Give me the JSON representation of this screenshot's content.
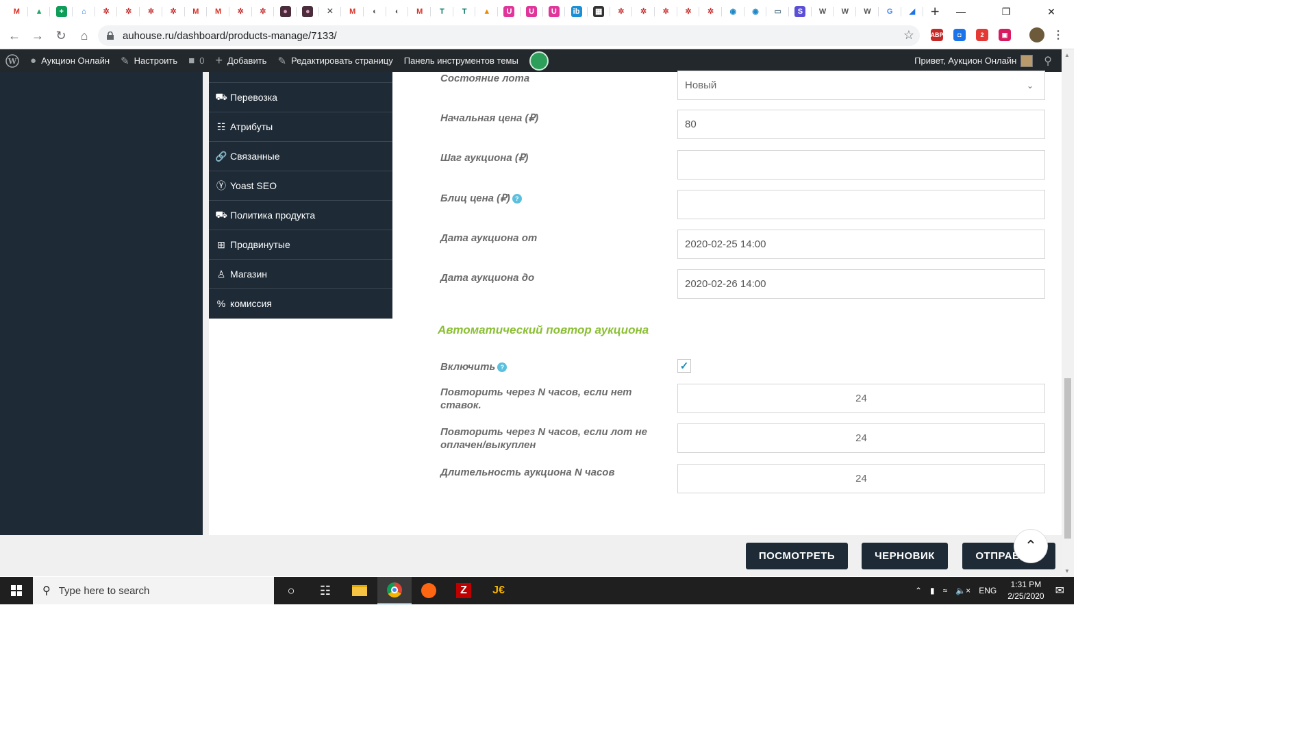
{
  "browser": {
    "favicons": [
      {
        "glyph": "M",
        "bg": "#ffffff",
        "fg": "#d93025"
      },
      {
        "glyph": "▲",
        "bg": "#ffffff",
        "fg": "#1fa463"
      },
      {
        "glyph": "+",
        "bg": "#0f9d58",
        "fg": "#ffffff"
      },
      {
        "glyph": "⌂",
        "bg": "#ffffff",
        "fg": "#1a73e8"
      },
      {
        "glyph": "✲",
        "bg": "#ffffff",
        "fg": "#c62828"
      },
      {
        "glyph": "✲",
        "bg": "#ffffff",
        "fg": "#c62828"
      },
      {
        "glyph": "✲",
        "bg": "#ffffff",
        "fg": "#c62828"
      },
      {
        "glyph": "✲",
        "bg": "#ffffff",
        "fg": "#c62828"
      },
      {
        "glyph": "M",
        "bg": "#ffffff",
        "fg": "#d93025"
      },
      {
        "glyph": "M",
        "bg": "#ffffff",
        "fg": "#d93025"
      },
      {
        "glyph": "✲",
        "bg": "#ffffff",
        "fg": "#c62828"
      },
      {
        "glyph": "✲",
        "bg": "#ffffff",
        "fg": "#c62828"
      },
      {
        "glyph": "●",
        "bg": "#4a2c3a",
        "fg": "#d8a0c0"
      },
      {
        "glyph": "●",
        "bg": "#4a2c3a",
        "fg": "#d8a0c0"
      },
      {
        "glyph": "×",
        "bg": "#ffffff",
        "fg": "#333333"
      },
      {
        "glyph": "M",
        "bg": "#ffffff",
        "fg": "#d93025"
      },
      {
        "glyph": "◐",
        "bg": "#ffffff",
        "fg": "#555555"
      },
      {
        "glyph": "◐",
        "bg": "#ffffff",
        "fg": "#555555"
      },
      {
        "glyph": "M",
        "bg": "#ffffff",
        "fg": "#d93025"
      },
      {
        "glyph": "T",
        "bg": "#ffffff",
        "fg": "#0a7b6b"
      },
      {
        "glyph": "T",
        "bg": "#ffffff",
        "fg": "#0a7b6b"
      },
      {
        "glyph": "▲",
        "bg": "#ffffff",
        "fg": "#e68a00"
      },
      {
        "glyph": "U",
        "bg": "#e0359a",
        "fg": "#ffffff"
      },
      {
        "glyph": "U",
        "bg": "#e0359a",
        "fg": "#ffffff"
      },
      {
        "glyph": "U",
        "bg": "#e0359a",
        "fg": "#ffffff"
      },
      {
        "glyph": "ib",
        "bg": "#1a8fd6",
        "fg": "#ffffff"
      },
      {
        "glyph": "▦",
        "bg": "#333333",
        "fg": "#ffffff"
      },
      {
        "glyph": "✲",
        "bg": "#ffffff",
        "fg": "#c62828"
      },
      {
        "glyph": "✲",
        "bg": "#ffffff",
        "fg": "#c62828"
      },
      {
        "glyph": "✲",
        "bg": "#ffffff",
        "fg": "#c62828"
      },
      {
        "glyph": "✲",
        "bg": "#ffffff",
        "fg": "#c62828"
      },
      {
        "glyph": "✲",
        "bg": "#ffffff",
        "fg": "#c62828"
      },
      {
        "glyph": "◉",
        "bg": "#ffffff",
        "fg": "#1e88c8"
      },
      {
        "glyph": "◉",
        "bg": "#ffffff",
        "fg": "#1e88c8"
      },
      {
        "glyph": "▭",
        "bg": "#ffffff",
        "fg": "#607d8b"
      },
      {
        "glyph": "S",
        "bg": "#5b4fd6",
        "fg": "#ffffff"
      },
      {
        "glyph": "W",
        "bg": "#ffffff",
        "fg": "#555555"
      },
      {
        "glyph": "W",
        "bg": "#ffffff",
        "fg": "#555555"
      },
      {
        "glyph": "W",
        "bg": "#ffffff",
        "fg": "#555555"
      },
      {
        "glyph": "G",
        "bg": "#ffffff",
        "fg": "#4285f4"
      },
      {
        "glyph": "◢",
        "bg": "#ffffff",
        "fg": "#1a73e8"
      }
    ],
    "new_tab": "+",
    "url": "auhouse.ru/dashboard/products-manage/7133/",
    "extensions": [
      {
        "glyph": "ABP",
        "bg": "#c62828",
        "icon": "adblock-icon"
      },
      {
        "glyph": "◘",
        "bg": "#1a73e8",
        "icon": "screenshot-icon"
      },
      {
        "glyph": "2",
        "bg": "#e53935",
        "icon": "notification-badge-icon"
      },
      {
        "glyph": "▣",
        "bg": "#d81b60",
        "icon": "save-to-pocket-icon"
      }
    ]
  },
  "adminbar": {
    "site_name": "Аукцион Онлайн",
    "customize": "Настроить",
    "comments_count": "0",
    "add_new": "Добавить",
    "edit_page": "Редактировать страницу",
    "theme_panel": "Панель инструментов темы",
    "greeting": "Привет, Аукцион Онлайн"
  },
  "side_menu": [
    {
      "label": "Перевозка",
      "icon": "truck-icon",
      "glyph": "⛟"
    },
    {
      "label": "Атрибуты",
      "icon": "list-icon",
      "glyph": "☷"
    },
    {
      "label": "Связанные",
      "icon": "link-icon",
      "glyph": "🔗"
    },
    {
      "label": "Yoast SEO",
      "icon": "yoast-icon",
      "glyph": "Ⓨ"
    },
    {
      "label": "Политика продукта",
      "icon": "policy-truck-icon",
      "glyph": "⛟"
    },
    {
      "label": "Продвинутые",
      "icon": "grid-icon",
      "glyph": "⊞"
    },
    {
      "label": "Магазин",
      "icon": "user-icon",
      "glyph": "♙"
    },
    {
      "label": "комиссия",
      "icon": "percent-icon",
      "glyph": "%"
    }
  ],
  "form": {
    "lot_state": {
      "label": "Состояние лота",
      "value": "Новый"
    },
    "start_price": {
      "label": "Начальная цена (₽)",
      "value": "80"
    },
    "step": {
      "label": "Шаг аукциона (₽)",
      "value": ""
    },
    "blitz": {
      "label": "Блиц цена (₽)",
      "value": ""
    },
    "date_from": {
      "label": "Дата аукциона от",
      "value": "2020-02-25 14:00"
    },
    "date_to": {
      "label": "Дата аукциона до",
      "value": "2020-02-26 14:00"
    },
    "section_title": "Автоматический повтор аукциона",
    "enable": {
      "label": "Включить",
      "checked": true
    },
    "repeat_no_bids": {
      "label": "Повторить через N часов, если нет ставок.",
      "value": "24"
    },
    "repeat_unpaid": {
      "label": "Повторить через N часов, если лот не оплачен/выкуплен",
      "value": "24"
    },
    "duration": {
      "label": "Длительность аукциона N часов",
      "value": "24"
    }
  },
  "buttons": {
    "preview": "ПОСМОТРЕТЬ",
    "draft": "ЧЕРНОВИК",
    "submit": "ОТПРАВИТЬ"
  },
  "taskbar": {
    "search_placeholder": "Type here to search",
    "lang": "ENG",
    "time": "1:31 PM",
    "date": "2/25/2020"
  },
  "colors": {
    "dark": "#1e2b37",
    "accent_green": "#8bbf34",
    "help_blue": "#5bc0de",
    "check_blue": "#1e8cbe"
  }
}
